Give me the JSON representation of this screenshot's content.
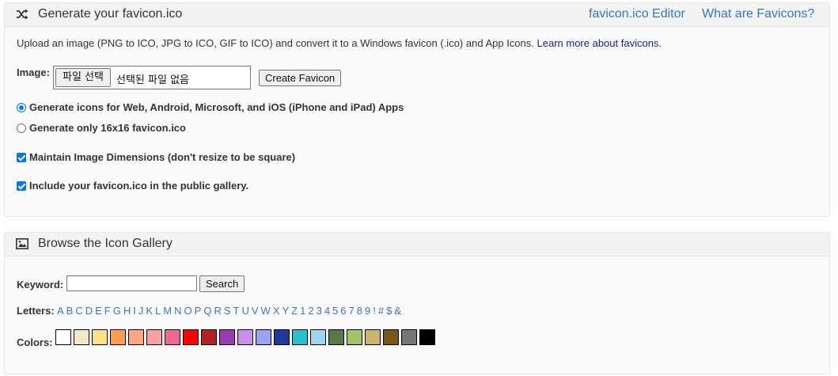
{
  "generate": {
    "title": "Generate your favicon.ico",
    "links": [
      "favicon.ico Editor",
      "What are Favicons?"
    ],
    "description": "Upload an image (PNG to ICO, JPG to ICO, GIF to ICO) and convert it to a Windows favicon (.ico) and App Icons. ",
    "learn_more": "Learn more about favicons",
    "learn_more_suffix": ".",
    "image_label": "Image:",
    "file_button": "파일 선택",
    "file_status": "선택된 파일 없음",
    "create_button": "Create Favicon",
    "options": [
      {
        "label": "Generate icons for Web, Android, Microsoft, and iOS (iPhone and iPad) Apps",
        "type": "radio",
        "checked": true
      },
      {
        "label": "Generate only 16x16 favicon.ico",
        "type": "radio",
        "checked": false
      },
      {
        "label": "Maintain Image Dimensions (don't resize to be square)",
        "type": "checkbox",
        "checked": true
      },
      {
        "label": "Include your favicon.ico in the public gallery.",
        "type": "checkbox",
        "checked": true
      }
    ]
  },
  "gallery": {
    "title": "Browse the Icon Gallery",
    "keyword_label": "Keyword:",
    "keyword_value": "",
    "search_button": "Search",
    "letters_label": "Letters:",
    "letters": [
      "A",
      "B",
      "C",
      "D",
      "E",
      "F",
      "G",
      "H",
      "I",
      "J",
      "K",
      "L",
      "M",
      "N",
      "O",
      "P",
      "Q",
      "R",
      "S",
      "T",
      "U",
      "V",
      "W",
      "X",
      "Y",
      "Z",
      "1",
      "2",
      "3",
      "4",
      "5",
      "6",
      "7",
      "8",
      "9",
      "!",
      "#",
      "$",
      "&"
    ],
    "colors_label": "Colors:",
    "colors": [
      "#ffffff",
      "#f3e7c7",
      "#ffe083",
      "#ff9f4f",
      "#ffa57f",
      "#f7a1a1",
      "#f06690",
      "#ff0000",
      "#b22222",
      "#9b3cb4",
      "#c890ee",
      "#9aa3ef",
      "#1e3b9c",
      "#27c2cc",
      "#9bd7f5",
      "#577a48",
      "#a4c462",
      "#c9b46e",
      "#7a5712",
      "#777777",
      "#000000"
    ]
  }
}
